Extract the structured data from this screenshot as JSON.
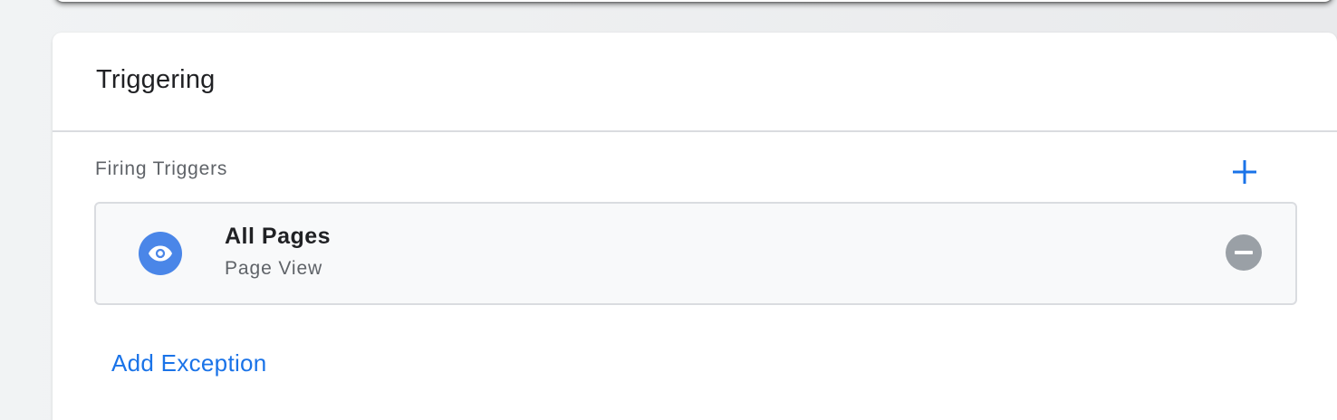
{
  "card": {
    "title": "Triggering"
  },
  "firing_triggers": {
    "label": "Firing Triggers",
    "add_icon": "plus-icon",
    "items": [
      {
        "name": "All Pages",
        "type": "Page View",
        "icon": "eye-icon",
        "remove_icon": "remove-circle-icon"
      }
    ]
  },
  "add_exception_label": "Add Exception",
  "colors": {
    "accent": "#1a73e8",
    "trigger_icon_bg": "#4a86e8",
    "remove_icon_bg": "#9aa0a6"
  }
}
